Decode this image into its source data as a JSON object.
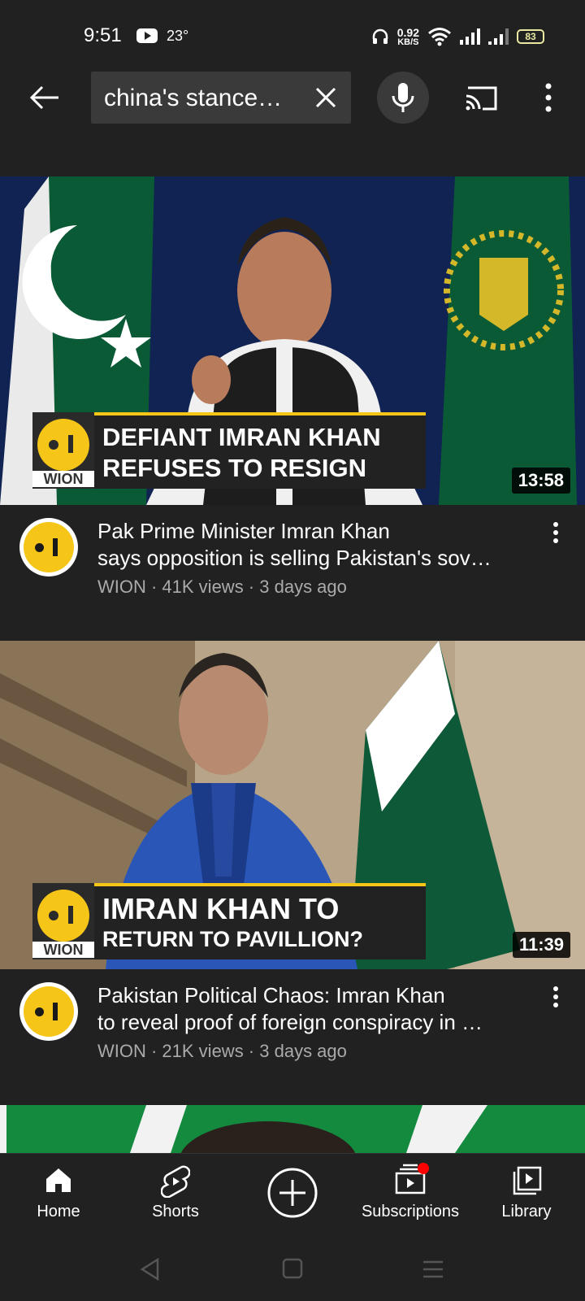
{
  "status_bar": {
    "time": "9:51",
    "temperature": "23°",
    "speed_value": "0.92",
    "speed_unit": "KB/S",
    "battery": "83"
  },
  "search": {
    "query": "china's stance…"
  },
  "videos": [
    {
      "thumbnail_headline_1": "DEFIANT IMRAN KHAN",
      "thumbnail_headline_2": "REFUSES TO RESIGN",
      "brand": "WION",
      "duration": "13:58",
      "title_line_1": "Pak Prime Minister Imran Khan",
      "title_line_2": "says opposition is selling Pakistan's sov…",
      "meta": "WION · 41K views · 3 days ago"
    },
    {
      "thumbnail_headline_1": "IMRAN KHAN TO",
      "thumbnail_headline_2": "RETURN TO PAVILLION?",
      "brand": "WION",
      "duration": "11:39",
      "title_line_1": "Pakistan Political Chaos: Imran Khan",
      "title_line_2": "to reveal proof of foreign conspiracy in …",
      "meta": "WION · 21K views · 3 days ago"
    }
  ],
  "bottom_nav": {
    "home": "Home",
    "shorts": "Shorts",
    "subscriptions": "Subscriptions",
    "library": "Library"
  },
  "colors": {
    "background": "#212121",
    "accent_yellow": "#f5c518",
    "notification_red": "#ff0000",
    "flag_green": "#0b4d2e"
  }
}
